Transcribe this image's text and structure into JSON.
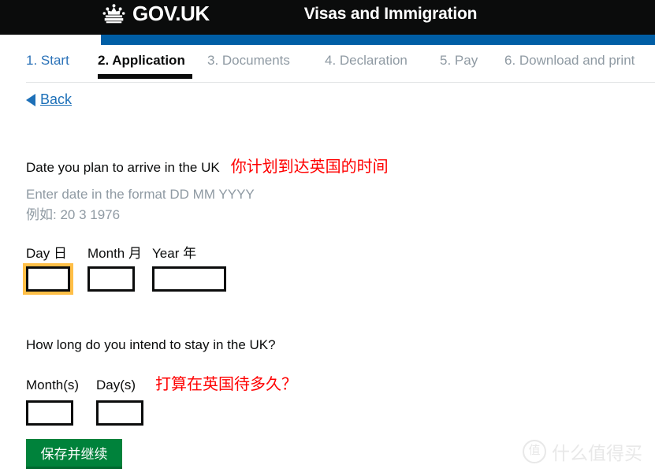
{
  "header": {
    "brand": "GOV.UK",
    "crown_icon": "crown-icon",
    "service_name": "Visas and Immigration"
  },
  "steps": [
    {
      "label": "1. Start",
      "state": "link"
    },
    {
      "label": "2. Application",
      "state": "current"
    },
    {
      "label": "3. Documents",
      "state": "inactive"
    },
    {
      "label": "4. Declaration",
      "state": "inactive"
    },
    {
      "label": "5. Pay",
      "state": "inactive"
    },
    {
      "label": "6. Download and print",
      "state": "inactive"
    }
  ],
  "back": {
    "label": "Back",
    "arrow_icon": "left-arrow-icon"
  },
  "form": {
    "arrival": {
      "question": "Date you plan to arrive in the UK",
      "annotation_cn": "你计划到达英国的时间",
      "hint": "Enter date in the format DD MM YYYY",
      "hint_cn": "例如:  20 3 1976",
      "day_label": "Day 日",
      "month_label": "Month 月",
      "year_label": "Year 年",
      "day_value": "",
      "month_value": "",
      "year_value": "",
      "focused_field": "day"
    },
    "duration": {
      "question": "How long do you intend to stay in the UK?",
      "annotation_cn": "打算在英国待多久？",
      "months_label": "Month(s)",
      "days_label": "Day(s)",
      "months_value": "",
      "days_value": ""
    }
  },
  "submit": {
    "label": "保存并继续"
  },
  "watermark": {
    "badge": "值",
    "text": "什么值得买"
  },
  "colors": {
    "header_black": "#0b0c0c",
    "brand_blue": "#005ea5",
    "link_blue": "#1d70b8",
    "step_link_blue": "#2b72b8",
    "muted_gray": "#8f9aa3",
    "annotation_red": "#ff0000",
    "focus_yellow": "#ffbf47",
    "button_green": "#00823b"
  }
}
